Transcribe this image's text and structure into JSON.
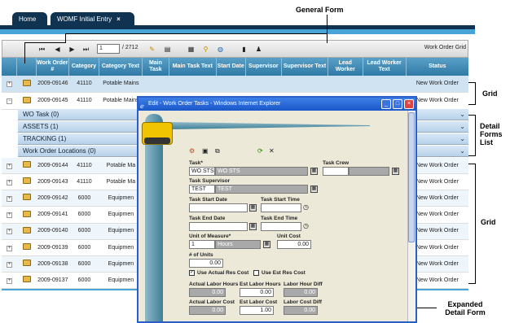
{
  "tabs": {
    "home": "Home",
    "womf": "WOMF Initial Entry",
    "close": "×"
  },
  "callouts": {
    "general_form": "General Form",
    "grid_top": "Grid",
    "detail_forms_list": "Detail Forms List",
    "grid_bottom": "Grid",
    "expanded_detail_form": "Expanded Detail Form"
  },
  "toolbar": {
    "page_value": "1",
    "page_total": "/ 2712",
    "grid_title": "Work Order Grid"
  },
  "columns": [
    "Work Order #",
    "Category",
    "Category Text",
    "Main Task",
    "Main Task Text",
    "Start Date",
    "Supervisor",
    "Supervisor Text",
    "Lead Worker",
    "Lead Worker Text",
    "Status"
  ],
  "rows_top": [
    {
      "wo": "2009-09146",
      "cat": "41110",
      "cat_text": "Potable Mains",
      "status": "New Work Order",
      "expander": "+"
    },
    {
      "wo": "2009-09145",
      "cat": "41110",
      "cat_text": "Potable Mains",
      "status": "New Work Order",
      "expander": "−"
    }
  ],
  "detail_forms": [
    "WO Task (0)",
    "ASSETS (1)",
    "TRACKING (1)",
    "Work Order Locations (0)"
  ],
  "rows_bottom": [
    {
      "wo": "2009-09144",
      "cat": "41110",
      "cat_text": "Potable Ma",
      "status": "New Work Order"
    },
    {
      "wo": "2009-09143",
      "cat": "41110",
      "cat_text": "Potable Ma",
      "status": "New Work Order"
    },
    {
      "wo": "2009-09142",
      "cat": "6000",
      "cat_text": "Equipmen",
      "status": "New Work Order"
    },
    {
      "wo": "2009-09141",
      "cat": "6000",
      "cat_text": "Equipmen",
      "status": "New Work Order"
    },
    {
      "wo": "2009-09140",
      "cat": "6000",
      "cat_text": "Equipmen",
      "status": "New Work Order"
    },
    {
      "wo": "2009-09139",
      "cat": "6000",
      "cat_text": "Equipmen",
      "status": "New Work Order"
    },
    {
      "wo": "2009-09138",
      "cat": "6000",
      "cat_text": "Equipmen",
      "status": "New Work Order"
    },
    {
      "wo": "2009-09137",
      "cat": "6000",
      "cat_text": "Equipmen",
      "status": "New Work Order"
    }
  ],
  "dialog": {
    "title": "Edit - Work Order Tasks - Windows Internet Explorer",
    "task_label": "Task*",
    "task_code": "WO STS",
    "task_desc": "WO STS",
    "task_crew_label": "Task Crew",
    "task_supervisor_label": "Task Supervisor",
    "task_supervisor_code": "TEST",
    "task_supervisor_name": "TEST",
    "task_start_date_label": "Task Start Date",
    "task_start_time_label": "Task Start Time",
    "task_end_date_label": "Task End Date",
    "task_end_time_label": "Task End Time",
    "uom_label": "Unit of Measure*",
    "uom_code": "1",
    "uom_name": "Hours",
    "unit_cost_label": "Unit Cost",
    "unit_cost_value": "0.00",
    "num_units_label": "# of Units",
    "num_units_value": "0.00",
    "use_actual_label": "Use Actual Res Cost",
    "use_est_label": "Use Est Res Cost",
    "actual_hours_label": "Actual Labor Hours",
    "est_hours_label": "Est Labor Hours",
    "hours_diff_label": "Labor Hour Diff",
    "actual_hours_value": "0.00",
    "est_hours_value": "0.00",
    "hours_diff_value": "0.00",
    "actual_cost_label": "Actual Labor Cost",
    "est_cost_label": "Est Labor Cost",
    "cost_diff_label": "Labor Cost Diff",
    "actual_cost_value": "0.00",
    "est_cost_value": "1.00",
    "cost_diff_value": "0.00"
  },
  "colors": {
    "header": "#2f7aa6",
    "tabbar": "#0f3350",
    "dialog_title": "#1a56c9"
  }
}
